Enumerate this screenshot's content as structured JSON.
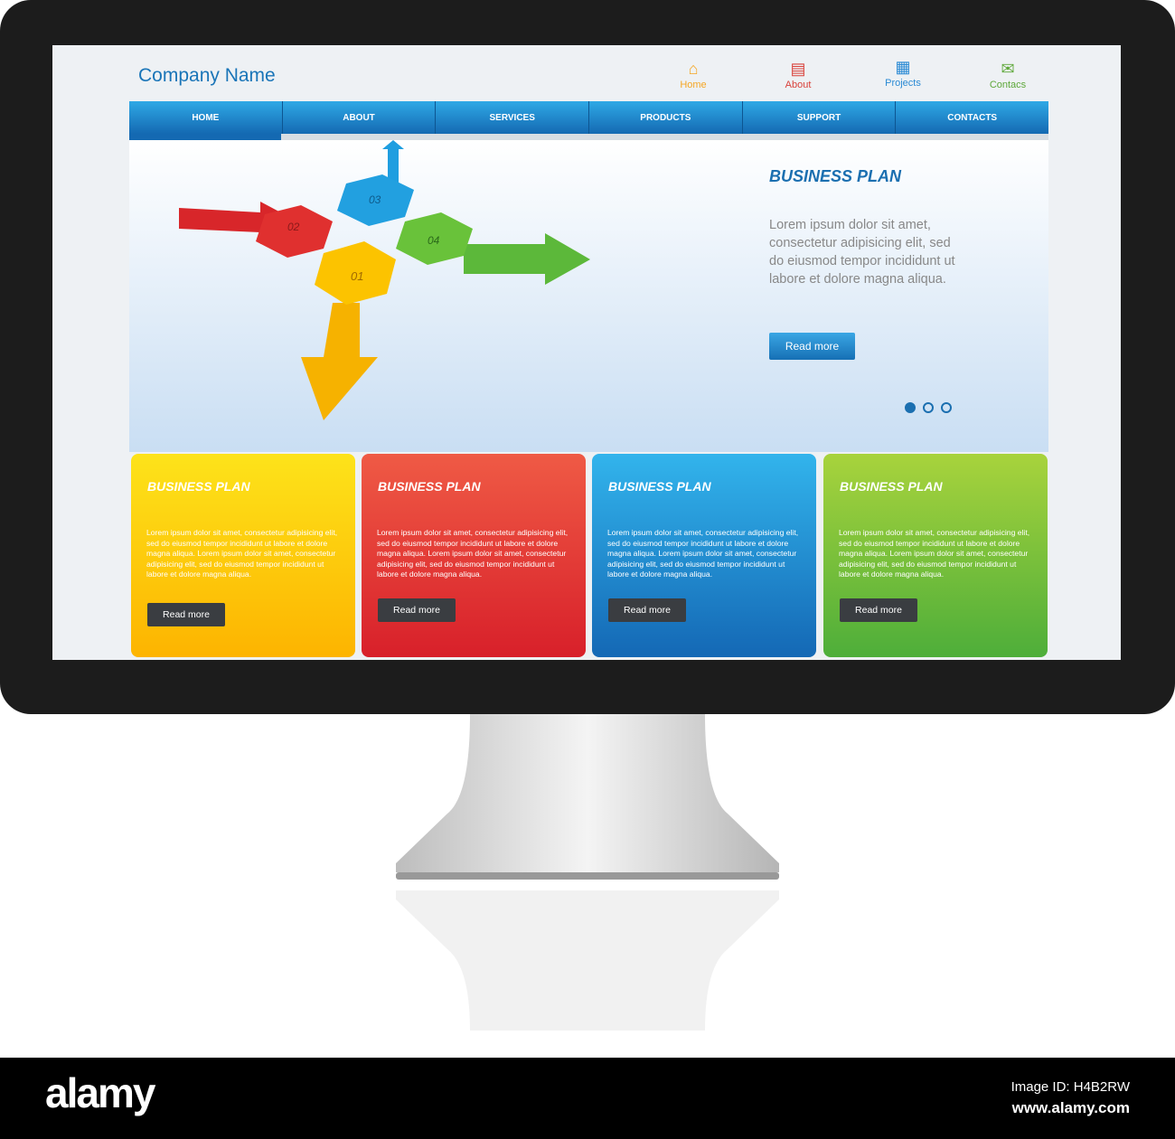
{
  "site": {
    "company_name": "Company Name",
    "top_links": [
      {
        "label": "Home",
        "icon": "home-icon",
        "color": "#f5a623"
      },
      {
        "label": "About",
        "icon": "document-icon",
        "color": "#d9413a"
      },
      {
        "label": "Projects",
        "icon": "grid-icon",
        "color": "#2a8ad4"
      },
      {
        "label": "Contacs",
        "icon": "envelope-icon",
        "color": "#5ea83a"
      }
    ],
    "nav": [
      "HOME",
      "ABOUT",
      "SERVICES",
      "PRODUCTS",
      "SUPPORT",
      "CONTACTS"
    ],
    "hero": {
      "title": "BUSINESS PLAN",
      "text": "Lorem ipsum dolor sit amet, consectetur adipisicing elit, sed do eiusmod tempor incididunt ut labore et dolore magna aliqua.",
      "button": "Read more",
      "steps": [
        "01",
        "02",
        "03",
        "04"
      ],
      "slide_active": 1,
      "slide_count": 3
    },
    "cards": [
      {
        "title": "BUSINESS PLAN",
        "text": "Lorem ipsum dolor sit amet, consectetur adipisicing elit, sed do eiusmod tempor incididunt ut labore et dolore magna aliqua. Lorem ipsum dolor sit amet, consectetur adipisicing elit, sed do eiusmod tempor incididunt ut labore et dolore magna aliqua.",
        "button": "Read more",
        "color": "#fdc400"
      },
      {
        "title": "BUSINESS PLAN",
        "text": "Lorem ipsum dolor sit amet, consectetur adipisicing elit, sed do eiusmod tempor incididunt ut labore et dolore magna aliqua. Lorem ipsum dolor sit amet, consectetur adipisicing elit, sed do eiusmod tempor incididunt ut labore et dolore magna aliqua.",
        "button": "Read more",
        "color": "#e0302f"
      },
      {
        "title": "BUSINESS PLAN",
        "text": "Lorem ipsum dolor sit amet, consectetur adipisicing elit, sed do eiusmod tempor incididunt ut labore et dolore magna aliqua. Lorem ipsum dolor sit amet, consectetur adipisicing elit, sed do eiusmod tempor incididunt ut labore et dolore magna aliqua.",
        "button": "Read more",
        "color": "#1e88d0"
      },
      {
        "title": "BUSINESS PLAN",
        "text": "Lorem ipsum dolor sit amet, consectetur adipisicing elit, sed do eiusmod tempor incididunt ut labore et dolore magna aliqua. Lorem ipsum dolor sit amet, consectetur adipisicing elit, sed do eiusmod tempor incididunt ut labore et dolore magna aliqua.",
        "button": "Read more",
        "color": "#69b92e"
      }
    ]
  },
  "footer": {
    "brand": "alamy",
    "image_id": "Image ID: H4B2RW",
    "url": "www.alamy.com"
  }
}
